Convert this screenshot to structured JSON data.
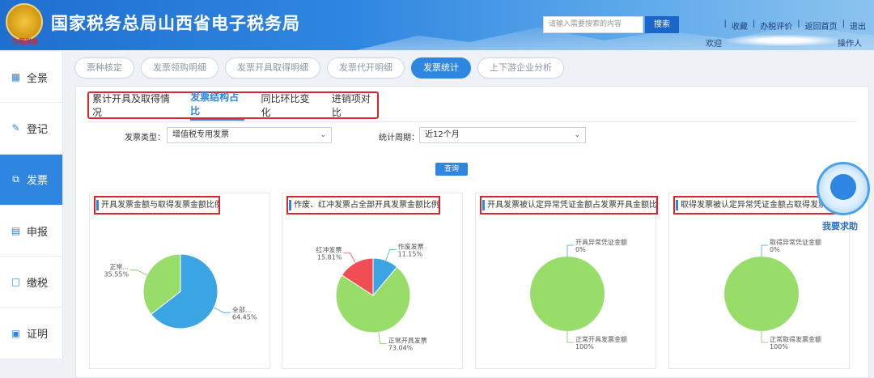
{
  "header": {
    "emblem_caption": "中国税务",
    "title": "国家税务总局山西省电子税务局",
    "search_placeholder": "请输入需要搜索的内容",
    "search_button": "搜索",
    "links": [
      "收藏",
      "办税评价",
      "返回首页",
      "退出"
    ],
    "welcome_prefix": "欢迎",
    "welcome_suffix": "操作人"
  },
  "sidebar": {
    "items": [
      {
        "label": "全景",
        "icon": "grid-icon"
      },
      {
        "label": "登记",
        "icon": "register-icon"
      },
      {
        "label": "发票",
        "icon": "invoice-icon",
        "active": true
      },
      {
        "label": "申报",
        "icon": "declare-icon"
      },
      {
        "label": "缴税",
        "icon": "pay-icon"
      },
      {
        "label": "证明",
        "icon": "certificate-icon"
      }
    ]
  },
  "top_tabs": [
    "票种核定",
    "发票领购明细",
    "发票开具取得明细",
    "发票代开明细",
    "发票统计",
    "上下游企业分析"
  ],
  "top_tab_active": 4,
  "sub_tabs": [
    "累计开具及取得情况",
    "发票结构占比",
    "同比环比变化",
    "进销项对比"
  ],
  "sub_tab_active": 1,
  "filters": {
    "type_label": "发票类型：",
    "type_value": "增值税专用发票",
    "period_label": "统计周期：",
    "period_value": "近12个月",
    "query_button": "查询"
  },
  "help": {
    "label": "我要求助"
  },
  "chart_data": [
    {
      "type": "pie",
      "title": "开具发票金额与取得发票金额比例",
      "labels": [
        "全部...",
        "正常..."
      ],
      "values": [
        64.45,
        35.55
      ],
      "display": [
        "64.45%",
        "35.55%"
      ],
      "colors": [
        "#3ba5e3",
        "#98dd6a"
      ]
    },
    {
      "type": "pie",
      "title": "作废、红冲发票占全部开具发票金额比例",
      "labels": [
        "作废发票",
        "正常开具发票",
        "红冲发票"
      ],
      "values": [
        11.15,
        73.04,
        15.81
      ],
      "display": [
        "11.15%",
        "73.04%",
        "15.81%"
      ],
      "colors": [
        "#3ba5e3",
        "#98dd6a",
        "#f04e54"
      ]
    },
    {
      "type": "pie",
      "title": "开具发票被认定异常凭证金额占发票开具金额比例",
      "labels": [
        "开具异常凭证金额",
        "正常开具发票金额"
      ],
      "values": [
        0,
        100
      ],
      "display": [
        "0%",
        "100%"
      ],
      "colors": [
        "#3ba5e3",
        "#98dd6a"
      ]
    },
    {
      "type": "pie",
      "title": "取得发票被认定异常凭证金额占取得发票比例",
      "labels": [
        "取得异常凭证金额",
        "正常取得发票金额"
      ],
      "values": [
        0,
        100
      ],
      "display": [
        "0%",
        "100%"
      ],
      "colors": [
        "#3ba5e3",
        "#98dd6a"
      ]
    }
  ]
}
